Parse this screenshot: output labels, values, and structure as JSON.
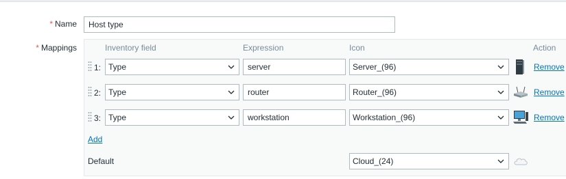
{
  "form": {
    "name_label": "Name",
    "name_value": "Host type",
    "mappings_label": "Mappings",
    "required_mark": "*"
  },
  "table": {
    "headers": {
      "inventory_field": "Inventory field",
      "expression": "Expression",
      "icon": "Icon",
      "action": "Action"
    },
    "rows": [
      {
        "num": "1:",
        "field": "Type",
        "expression": "server",
        "icon": "Server_(96)",
        "icon_preview": "server-icon",
        "action": "Remove"
      },
      {
        "num": "2:",
        "field": "Type",
        "expression": "router",
        "icon": "Router_(96)",
        "icon_preview": "router-icon",
        "action": "Remove"
      },
      {
        "num": "3:",
        "field": "Type",
        "expression": "workstation",
        "icon": "Workstation_(96)",
        "icon_preview": "workstation-icon",
        "action": "Remove"
      }
    ],
    "add_label": "Add",
    "default_label": "Default",
    "default_icon": "Cloud_(24)",
    "default_icon_preview": "cloud-icon"
  },
  "colors": {
    "required": "#e45959",
    "link": "#0275b8",
    "header_text": "#768d99",
    "border": "#acbbc2"
  }
}
